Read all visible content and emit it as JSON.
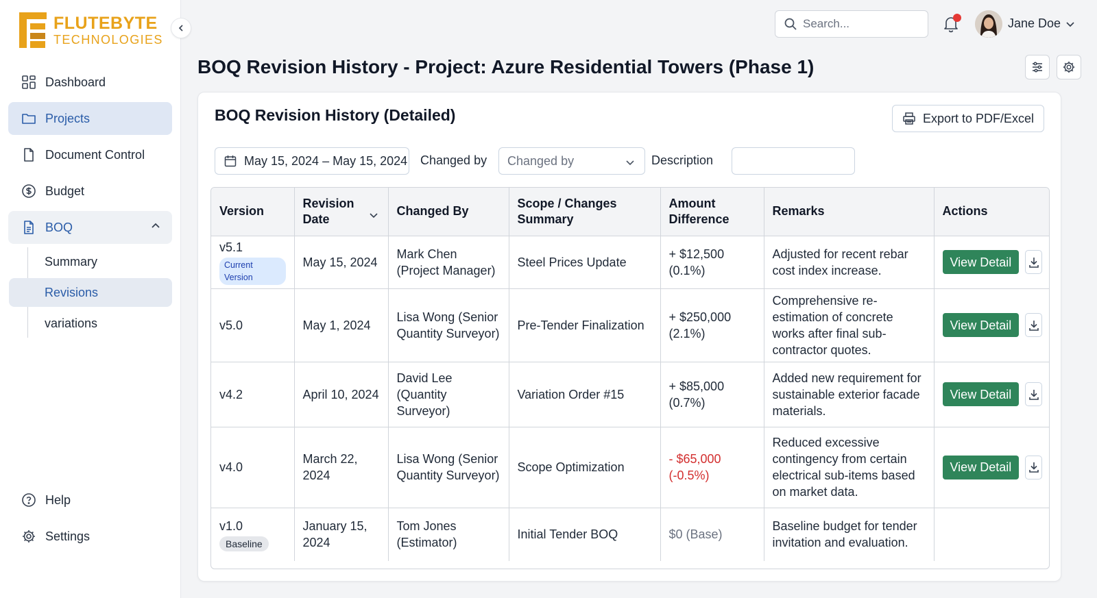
{
  "brand": {
    "name": "FLUTEBYTE",
    "sub": "TECHNOLOGIES",
    "color": "#e8a21a"
  },
  "sidebar": {
    "items": [
      {
        "label": "Dashboard",
        "icon": "grid-icon"
      },
      {
        "label": "Projects",
        "icon": "folder-icon",
        "active": true
      },
      {
        "label": "Document Control",
        "icon": "document-icon"
      },
      {
        "label": "Budget",
        "icon": "dollar-icon"
      },
      {
        "label": "BOQ",
        "icon": "file-text-icon",
        "expanded": true
      }
    ],
    "boq_sub": [
      {
        "label": "Summary"
      },
      {
        "label": "Revisions",
        "active": true
      },
      {
        "label": "variations"
      }
    ],
    "bottom": [
      {
        "label": "Help",
        "icon": "help-icon"
      },
      {
        "label": "Settings",
        "icon": "gear-icon"
      }
    ]
  },
  "topbar": {
    "search_placeholder": "Search...",
    "user_name": "Jane Doe",
    "has_notification": true
  },
  "page": {
    "title_bold": "BOQ Revision History",
    "title_rest": " - Project: Azure Residential Towers (Phase 1)"
  },
  "card": {
    "title": "BOQ Revision History (Detailed)",
    "export_label": "Export to PDF/Excel",
    "filters": {
      "date_range": "May 15, 2024 – May 15, 2024",
      "changed_by_label": "Changed by",
      "changed_by_placeholder": "Changed by",
      "description_label": "Description",
      "description_value": ""
    }
  },
  "table": {
    "headers": [
      "Version",
      "Revision Date",
      "Changed By",
      "Scope / Changes Summary",
      "Amount Difference",
      "Remarks",
      "Actions"
    ],
    "view_label": "View Detail",
    "rows": [
      {
        "version": "v5.1",
        "badge": "Current Version",
        "badge_type": "current",
        "date": "May 15, 2024",
        "changed_by": "Mark Chen (Project Manager)",
        "scope": "Steel Prices Update",
        "amount": "+ $12,500 (0.1%)",
        "amount_type": "pos",
        "remarks": "Adjusted for recent rebar cost index increase.",
        "has_actions": true
      },
      {
        "version": "v5.0",
        "badge": "",
        "badge_type": "",
        "date": "May 1, 2024",
        "changed_by": "Lisa Wong (Senior Quantity Surveyor)",
        "scope": "Pre-Tender Finalization",
        "amount": "+ $250,000 (2.1%)",
        "amount_type": "pos",
        "remarks": "Comprehensive re-estimation of concrete works after final sub-contractor quotes.",
        "has_actions": true
      },
      {
        "version": "v4.2",
        "badge": "",
        "badge_type": "",
        "date": "April 10, 2024",
        "changed_by": "David Lee (Quantity Surveyor)",
        "scope": "Variation Order #15",
        "amount": "+ $85,000 (0.7%)",
        "amount_type": "pos",
        "remarks": "Added new requirement for sustainable exterior facade materials.",
        "has_actions": true
      },
      {
        "version": "v4.0",
        "badge": "",
        "badge_type": "",
        "date": "March 22, 2024",
        "changed_by": "Lisa Wong (Senior Quantity Surveyor)",
        "scope": "Scope Optimization",
        "amount": "- $65,000 (-0.5%)",
        "amount_type": "neg",
        "remarks": "Reduced excessive contingency from certain electrical sub-items based on market data.",
        "has_actions": true
      },
      {
        "version": "v1.0",
        "badge": "Baseline",
        "badge_type": "base",
        "date": "January 15, 2024",
        "changed_by": "Tom Jones (Estimator)",
        "scope": "Initial Tender BOQ",
        "amount": "$0 (Base)",
        "amount_type": "base",
        "remarks": "Baseline budget for tender invitation and evaluation.",
        "has_actions": false
      }
    ]
  },
  "colors": {
    "accent": "#2a5ca8",
    "view_button": "#2f855a",
    "negative": "#d32f2f",
    "notification": "#e53935"
  }
}
